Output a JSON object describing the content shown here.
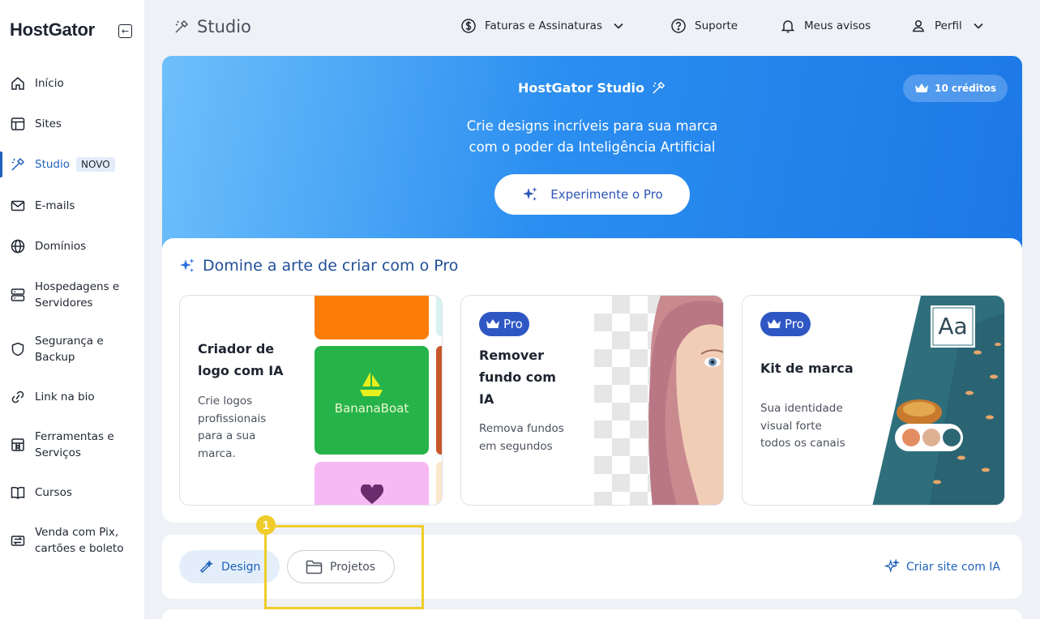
{
  "brand": {
    "logo_text": "HostGator"
  },
  "sidebar": {
    "items": [
      {
        "label": "Início",
        "icon": "home-icon"
      },
      {
        "label": "Sites",
        "icon": "layout-icon"
      },
      {
        "label": "Studio",
        "icon": "wand-icon",
        "badge": "NOVO",
        "active": true
      },
      {
        "label": "E-mails",
        "icon": "mail-icon"
      },
      {
        "label": "Domínios",
        "icon": "globe-icon"
      },
      {
        "label": "Hospedagens e",
        "label2": "Servidores",
        "icon": "server-icon"
      },
      {
        "label": "Segurança e",
        "label2": "Backup",
        "icon": "shield-icon"
      },
      {
        "label": "Link na bio",
        "icon": "link-icon"
      },
      {
        "label": "Ferramentas e",
        "label2": "Serviços",
        "icon": "tools-icon"
      },
      {
        "label": "Cursos",
        "icon": "book-icon"
      },
      {
        "label": "Venda com Pix,",
        "label2": "cartões e boleto",
        "icon": "payment-icon"
      }
    ]
  },
  "header": {
    "title": "Studio",
    "billing": "Faturas e Assinaturas",
    "support": "Suporte",
    "notices": "Meus avisos",
    "profile": "Perfil"
  },
  "hero": {
    "title": "HostGator Studio",
    "subtitle_line1": "Crie designs incríveis para sua marca",
    "subtitle_line2": "com o poder da Inteligência Artificial",
    "cta": "Experimente o Pro",
    "credits": "10 créditos"
  },
  "pro_section": {
    "heading": "Domine a arte de criar com o Pro",
    "cards": [
      {
        "title_l1": "Criador de",
        "title_l2": "logo com IA",
        "desc_l1": "Crie logos",
        "desc_l2": "profissionais",
        "desc_l3": "para a sua",
        "desc_l4": "marca.",
        "logo_sample": "BananaBoat"
      },
      {
        "pill": "Pro",
        "title_l1": "Remover",
        "title_l2": "fundo com",
        "title_l3": "IA",
        "desc_l1": "Remova fundos",
        "desc_l2": "em segundos"
      },
      {
        "pill": "Pro",
        "title_l1": "Kit de marca",
        "desc_l1": "Sua identidade",
        "desc_l2": "visual forte",
        "desc_l3": "todos os canais",
        "font_sample": "Aa"
      }
    ]
  },
  "tabs": {
    "design": "Design",
    "projetos": "Projetos",
    "site_ia": "Criar site com IA"
  },
  "annotation": {
    "number": "1"
  },
  "colors": {
    "accent": "#1f62b9",
    "hero_start": "#6ec0fb",
    "hero_end": "#1c78e6",
    "pro_pill": "#2f57c4",
    "highlight": "#f0cc2a"
  }
}
